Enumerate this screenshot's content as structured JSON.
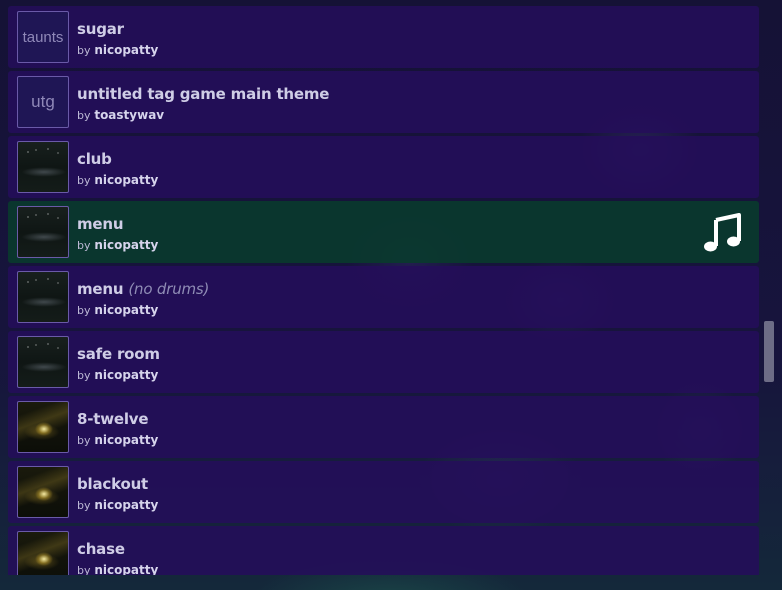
{
  "tracks": [
    {
      "thumb_text": "taunts",
      "title": "sugar",
      "suffix": "",
      "by": "by",
      "author": "nicopatty"
    },
    {
      "thumb_text": "utg",
      "title": "untitled tag game main theme",
      "suffix": "",
      "by": "by",
      "author": "toastywav"
    },
    {
      "thumb_text": "",
      "title": "club",
      "suffix": "",
      "by": "by",
      "author": "nicopatty"
    },
    {
      "thumb_text": "",
      "title": "menu",
      "suffix": "",
      "by": "by",
      "author": "nicopatty",
      "playing": true
    },
    {
      "thumb_text": "",
      "title": "menu",
      "suffix": "(no drums)",
      "by": "by",
      "author": "nicopatty"
    },
    {
      "thumb_text": "",
      "title": "safe room",
      "suffix": "",
      "by": "by",
      "author": "nicopatty"
    },
    {
      "thumb_text": "",
      "title": "8-twelve",
      "suffix": "",
      "by": "by",
      "author": "nicopatty"
    },
    {
      "thumb_text": "",
      "title": "blackout",
      "suffix": "",
      "by": "by",
      "author": "nicopatty"
    },
    {
      "thumb_text": "",
      "title": "chase",
      "suffix": "",
      "by": "by",
      "author": "nicopatty"
    }
  ],
  "icons": {
    "now_playing": "music-note-icon"
  },
  "colors": {
    "row_background": "#240e5a",
    "active_row_background": "#0a3a2e",
    "title_text": "#cfcde6",
    "suffix_text": "#8f8cb5"
  }
}
